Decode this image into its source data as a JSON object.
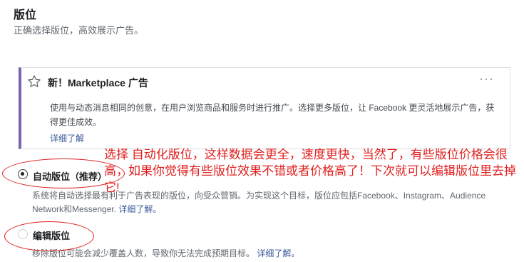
{
  "section": {
    "title": "版位",
    "subtitle": "正确选择版位，高效展示广告。"
  },
  "card": {
    "title": "新！Marketplace 广告",
    "body": "使用与动态消息相同的创意，在用户浏览商品和服务时进行推广。选择更多版位，让 Facebook 更灵活地展示广告，获得更佳成效。",
    "link": "详细了解",
    "icon": "star-outline-icon",
    "menu": "···"
  },
  "options": [
    {
      "label": "自动版位（推荐）",
      "selected": true,
      "description": "系统将自动选择最有利于广告表现的版位，向受众营销。为实现这个目标，版位应包括Facebook、Instagram、Audience Network和Messenger.",
      "link": "详细了解。"
    },
    {
      "label": "编辑版位",
      "selected": false,
      "description": "移除版位可能会减少覆盖人数，导致你无法完成预期目标。",
      "link": "详细了解。"
    }
  ],
  "annotation": {
    "text": "选择 自动化版位，这样数据会更全，速度更快，当然了，有些版位价格会很高，如果你觉得有些版位效果不错或者价格高了！下次就可以编辑版位里去掉它!",
    "color": "#e02020"
  },
  "colors": {
    "accent": "#7a64b1",
    "link": "#385898"
  }
}
